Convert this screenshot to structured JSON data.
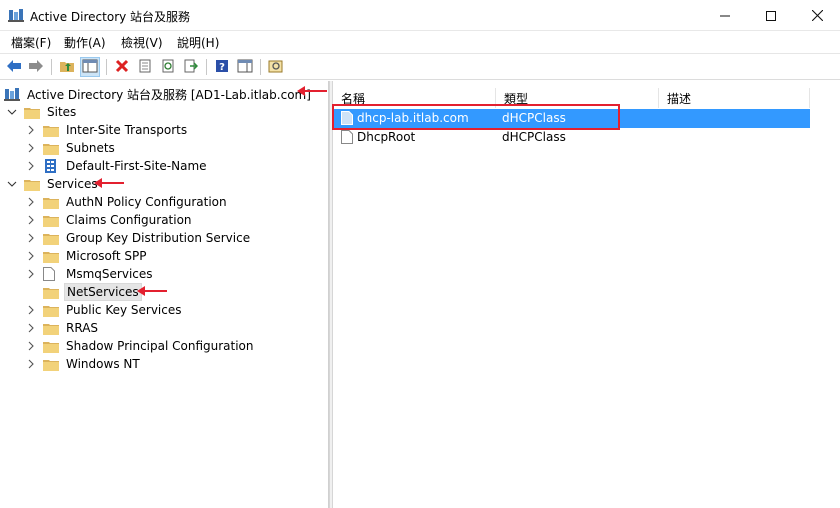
{
  "window": {
    "title": "Active Directory 站台及服務"
  },
  "menu": {
    "file": "檔案(F)",
    "action": "動作(A)",
    "view": "檢視(V)",
    "help": "說明(H)"
  },
  "tree": {
    "root": "Active Directory 站台及服務 [AD1-Lab.itlab.com]",
    "sites": "Sites",
    "sites_children": [
      "Inter-Site Transports",
      "Subnets",
      "Default-First-Site-Name"
    ],
    "services": "Services",
    "services_children": [
      "AuthN Policy Configuration",
      "Claims Configuration",
      "Group Key Distribution Service",
      "Microsoft SPP",
      "MsmqServices",
      "NetServices",
      "Public Key Services",
      "RRAS",
      "Shadow Principal Configuration",
      "Windows NT"
    ]
  },
  "list": {
    "columns": [
      "名稱",
      "類型",
      "描述"
    ],
    "rows": [
      {
        "name": "dhcp-lab.itlab.com",
        "type": "dHCPClass",
        "description": ""
      },
      {
        "name": "DhcpRoot",
        "type": "dHCPClass",
        "description": ""
      }
    ],
    "selected_row": 0
  },
  "colors": {
    "selection": "#3399ff",
    "annotation": "#e3202f",
    "folder": "#dcb35c"
  },
  "icons": [
    "app-icon",
    "back-arrow-icon",
    "forward-arrow-icon",
    "up-folder-icon",
    "show-hide-tree-icon",
    "delete-icon",
    "properties-icon",
    "refresh-icon",
    "export-icon",
    "help-icon",
    "show-action-pane-icon",
    "find-icon",
    "folder-icon",
    "document-icon",
    "site-icon",
    "directory-root-icon"
  ]
}
